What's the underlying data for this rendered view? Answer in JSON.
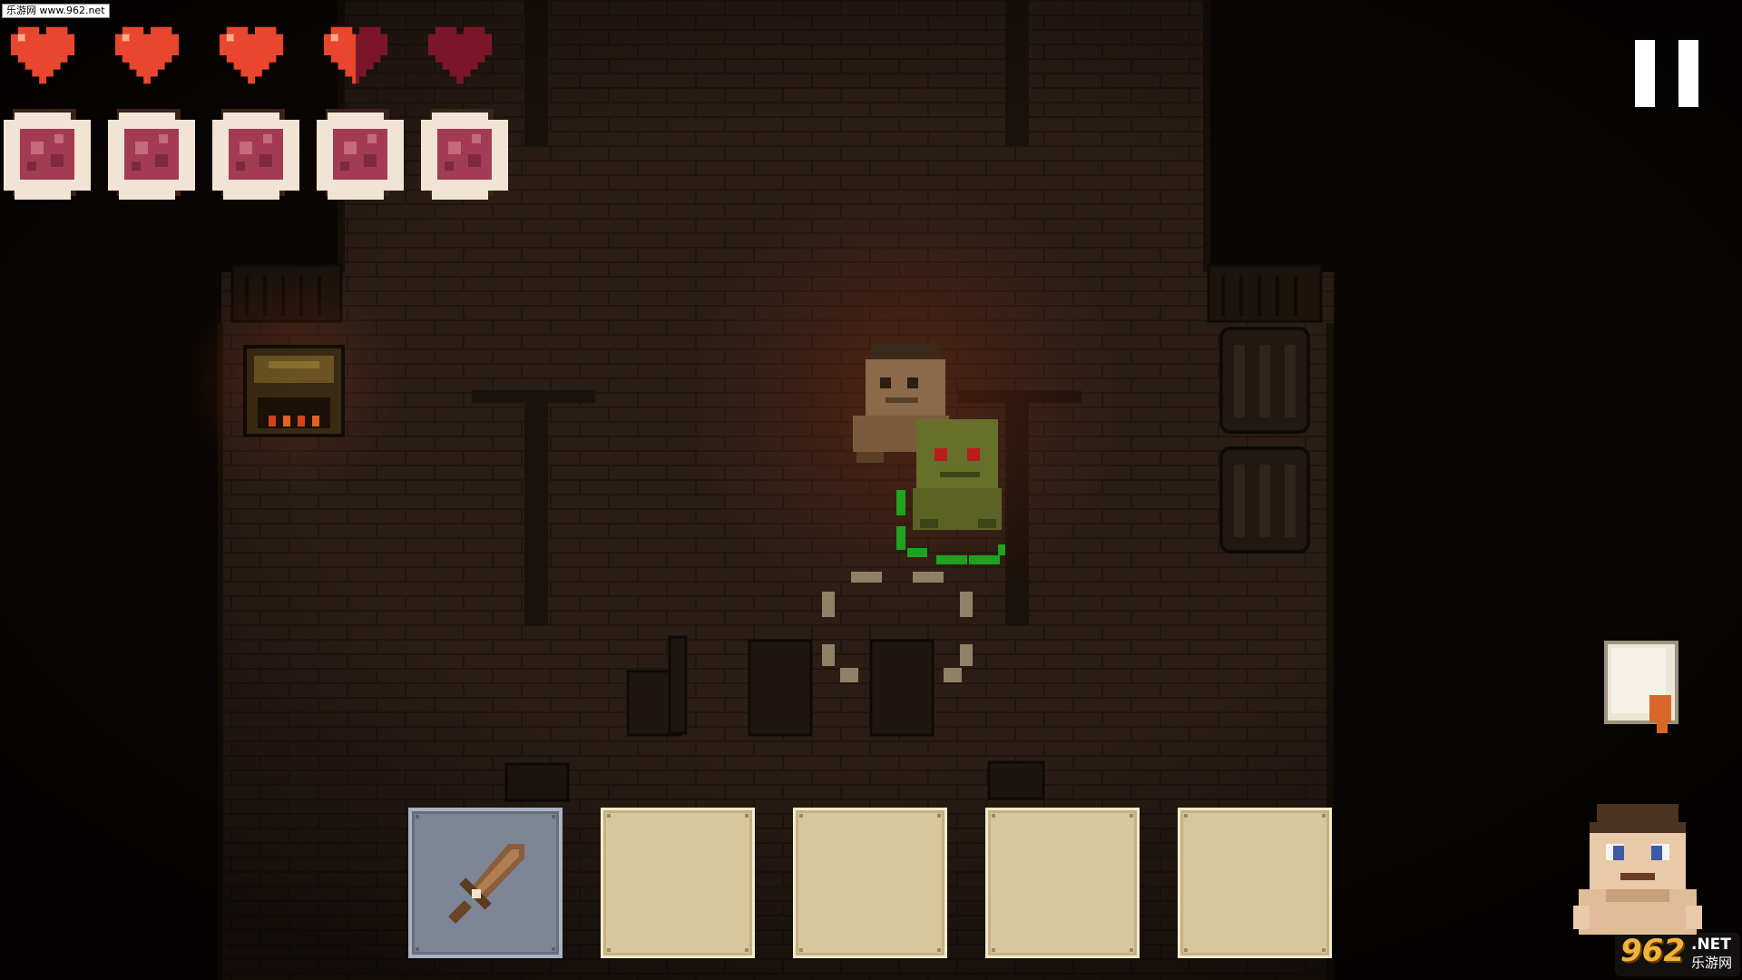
{
  "watermark": {
    "top_left": "乐游网 www.962.net",
    "main": "962",
    "net": ".NET",
    "sub": "乐游网"
  },
  "player": {
    "hearts_filled": 3.5,
    "hearts_max": 5,
    "food_filled": 5,
    "food_max": 5
  },
  "hotbar": {
    "slots": [
      "sword-icon",
      "",
      "",
      "",
      ""
    ],
    "selected_index": 0
  },
  "icons": {
    "pause": "pause-icon",
    "notes": "note-page-icon",
    "portrait": "player-portrait-icon"
  },
  "colors": {
    "heart_full": "#e8462d",
    "heart_empty": "#7a1628",
    "food": "#a33b55",
    "food_border": "#f2e4d4",
    "slot": "#d8c79a",
    "slot_selected": "#7d8597"
  }
}
